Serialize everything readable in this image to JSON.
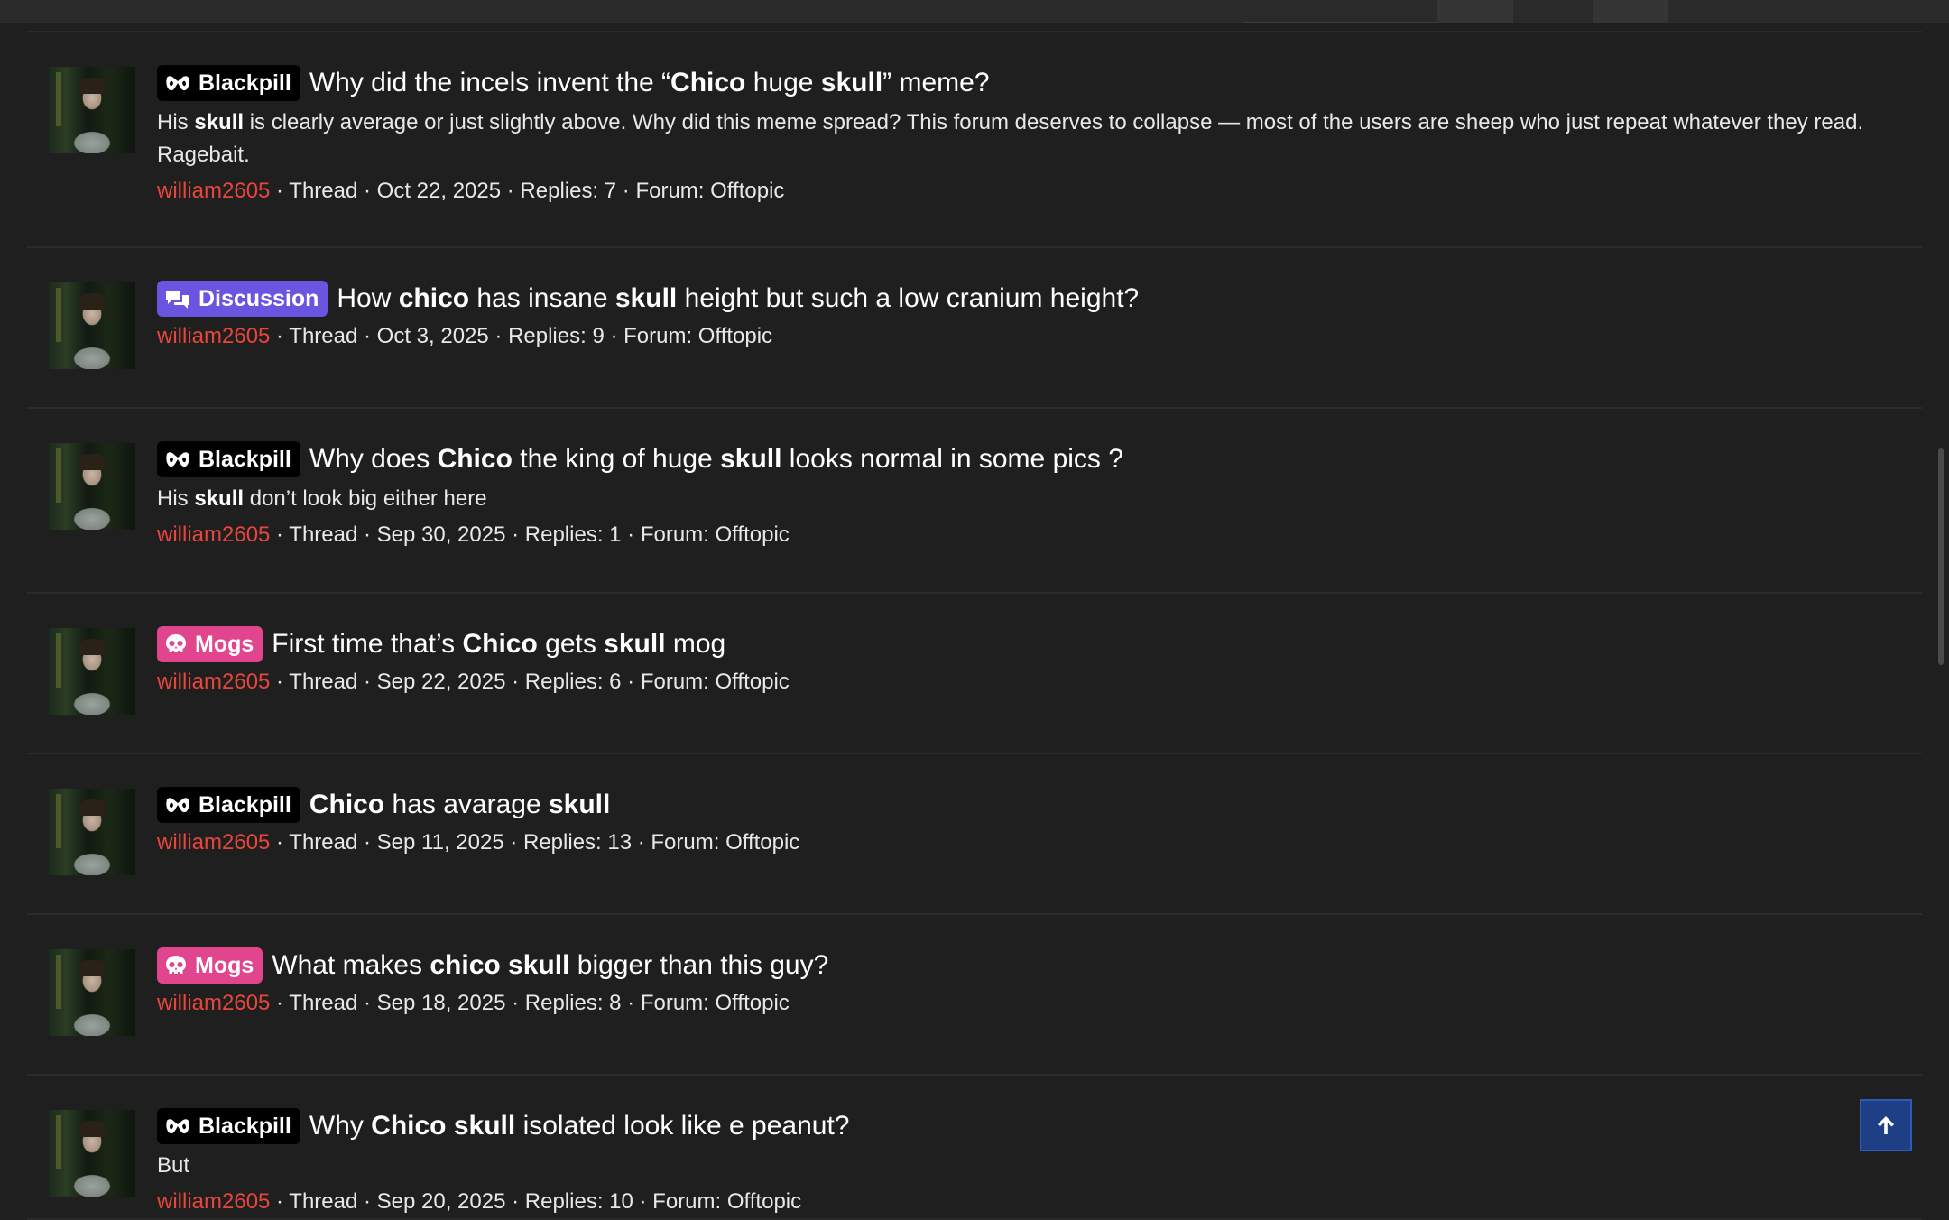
{
  "results": [
    {
      "label": "Blackpill",
      "label_type": "blackpill",
      "label_icon": "goggles-icon",
      "title": [
        [
          "Why did the incels invent the “",
          false
        ],
        [
          "Chico",
          true
        ],
        [
          " huge ",
          false
        ],
        [
          "skull",
          true
        ],
        [
          "” meme?",
          false
        ]
      ],
      "snippet": [
        [
          "His ",
          false
        ],
        [
          "skull",
          true
        ],
        [
          " is clearly average or just slightly above. Why did this meme spread? This forum deserves to collapse — most of the users are sheep who just repeat whatever they read. Ragebait.",
          false
        ]
      ],
      "user": "william2605",
      "meta": " · Thread · Oct 22, 2025 · Replies: 7 · Forum: Offtopic"
    },
    {
      "label": "Discussion",
      "label_type": "discussion",
      "label_icon": "chat-bubbles-icon",
      "title": [
        [
          "How ",
          false
        ],
        [
          "chico",
          true
        ],
        [
          " has insane ",
          false
        ],
        [
          "skull",
          true
        ],
        [
          " height but such a low cranium height?",
          false
        ]
      ],
      "snippet": null,
      "user": "william2605",
      "meta": " · Thread · Oct 3, 2025 · Replies: 9 · Forum: Offtopic"
    },
    {
      "label": "Blackpill",
      "label_type": "blackpill",
      "label_icon": "goggles-icon",
      "title": [
        [
          "Why does ",
          false
        ],
        [
          "Chico",
          true
        ],
        [
          " the king of huge ",
          false
        ],
        [
          "skull",
          true
        ],
        [
          " looks normal in some pics ?",
          false
        ]
      ],
      "snippet": [
        [
          "His ",
          false
        ],
        [
          "skull",
          true
        ],
        [
          " don’t look big either here",
          false
        ]
      ],
      "user": "william2605",
      "meta": " · Thread · Sep 30, 2025 · Replies: 1 · Forum: Offtopic"
    },
    {
      "label": "Mogs",
      "label_type": "mogs",
      "label_icon": "skull-icon",
      "title": [
        [
          "First time that’s ",
          false
        ],
        [
          "Chico",
          true
        ],
        [
          " gets ",
          false
        ],
        [
          "skull",
          true
        ],
        [
          " mog",
          false
        ]
      ],
      "snippet": null,
      "user": "william2605",
      "meta": " · Thread · Sep 22, 2025 · Replies: 6 · Forum: Offtopic"
    },
    {
      "label": "Blackpill",
      "label_type": "blackpill",
      "label_icon": "goggles-icon",
      "title": [
        [
          "Chico",
          true
        ],
        [
          " has avarage ",
          false
        ],
        [
          "skull",
          true
        ]
      ],
      "snippet": null,
      "user": "william2605",
      "meta": " · Thread · Sep 11, 2025 · Replies: 13 · Forum: Offtopic"
    },
    {
      "label": "Mogs",
      "label_type": "mogs",
      "label_icon": "skull-icon",
      "title": [
        [
          "What makes ",
          false
        ],
        [
          "chico",
          true
        ],
        [
          " ",
          false
        ],
        [
          "skull",
          true
        ],
        [
          " bigger than this guy?",
          false
        ]
      ],
      "snippet": null,
      "user": "william2605",
      "meta": " · Thread · Sep 18, 2025 · Replies: 8 · Forum: Offtopic"
    },
    {
      "label": "Blackpill",
      "label_type": "blackpill",
      "label_icon": "goggles-icon",
      "title": [
        [
          "Why ",
          false
        ],
        [
          "Chico",
          true
        ],
        [
          " ",
          false
        ],
        [
          "skull",
          true
        ],
        [
          " isolated look like e peanut?",
          false
        ]
      ],
      "snippet": [
        [
          "But",
          false
        ]
      ],
      "user": "william2605",
      "meta": " · Thread · Sep 20, 2025 · Replies: 10 · Forum: Offtopic"
    }
  ],
  "scroll_top_button": {
    "icon": "arrow-up-icon"
  },
  "colors": {
    "background": "#1f1f1f",
    "username": "#e8453c",
    "label_blackpill": "#000000",
    "label_discussion": "#6a55e0",
    "label_mogs": "#e0458e",
    "scroll_top_button": "#1e3f86"
  }
}
